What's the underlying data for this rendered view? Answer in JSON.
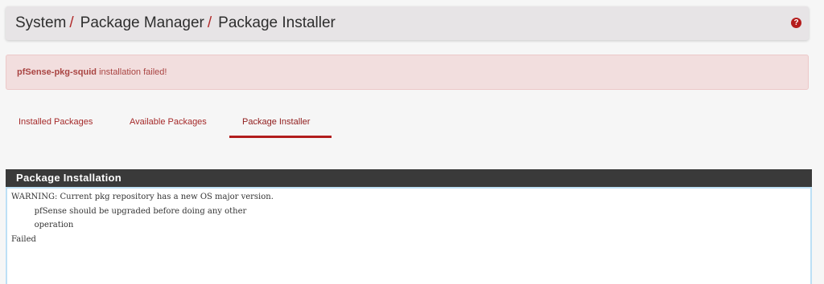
{
  "breadcrumb": {
    "items": [
      "System",
      "Package Manager",
      "Package Installer"
    ],
    "separator": "/"
  },
  "help_icon": {
    "glyph": "?",
    "color": "#b51c1c"
  },
  "alert": {
    "package": "pfSense-pkg-squid",
    "message": " installation failed!"
  },
  "tabs": {
    "installed": "Installed Packages",
    "available": "Available Packages",
    "installer": "Package Installer",
    "active": "Package Installer"
  },
  "panel": {
    "title": "Package Installation",
    "output": "WARNING: Current pkg repository has a new OS major version.\n         pfSense should be upgraded before doing any other\n         operation\nFailed"
  },
  "colors": {
    "accent": "#b21d1d",
    "alert_bg": "#f2dede",
    "alert_text": "#a94442",
    "panel_heading": "#3a3a3a",
    "console_border": "#bde0f5"
  }
}
